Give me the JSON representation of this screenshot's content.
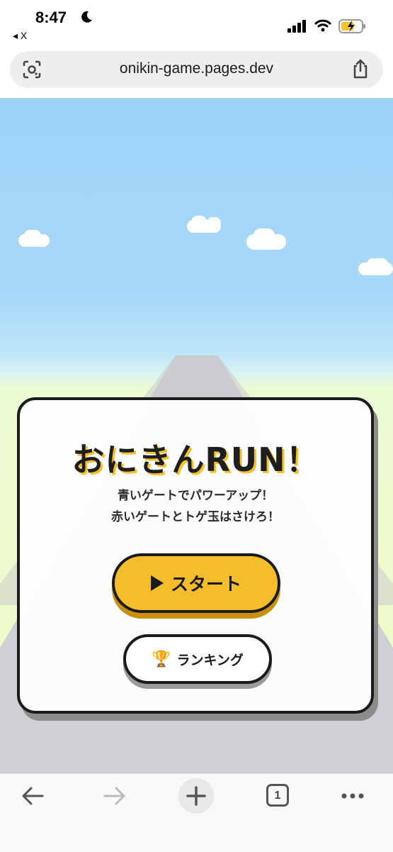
{
  "status_bar": {
    "time": "8:47",
    "back_app": "◂ X"
  },
  "url_bar": {
    "url": "onikin-game.pages.dev"
  },
  "game": {
    "title": "おにきんRUN！",
    "description_line1": "青いゲートでパワーアップ！",
    "description_line2": "赤いゲートとトゲ玉はさけろ！",
    "start_label": "スタート",
    "ranking_label": "ランキング",
    "trophy_glyph": "🏆",
    "colors": {
      "start_button": "#f4bd2c",
      "sky": "#9dd2f9",
      "grass": "#f1fbc6"
    }
  },
  "toolbar": {
    "tab_count": "1"
  }
}
